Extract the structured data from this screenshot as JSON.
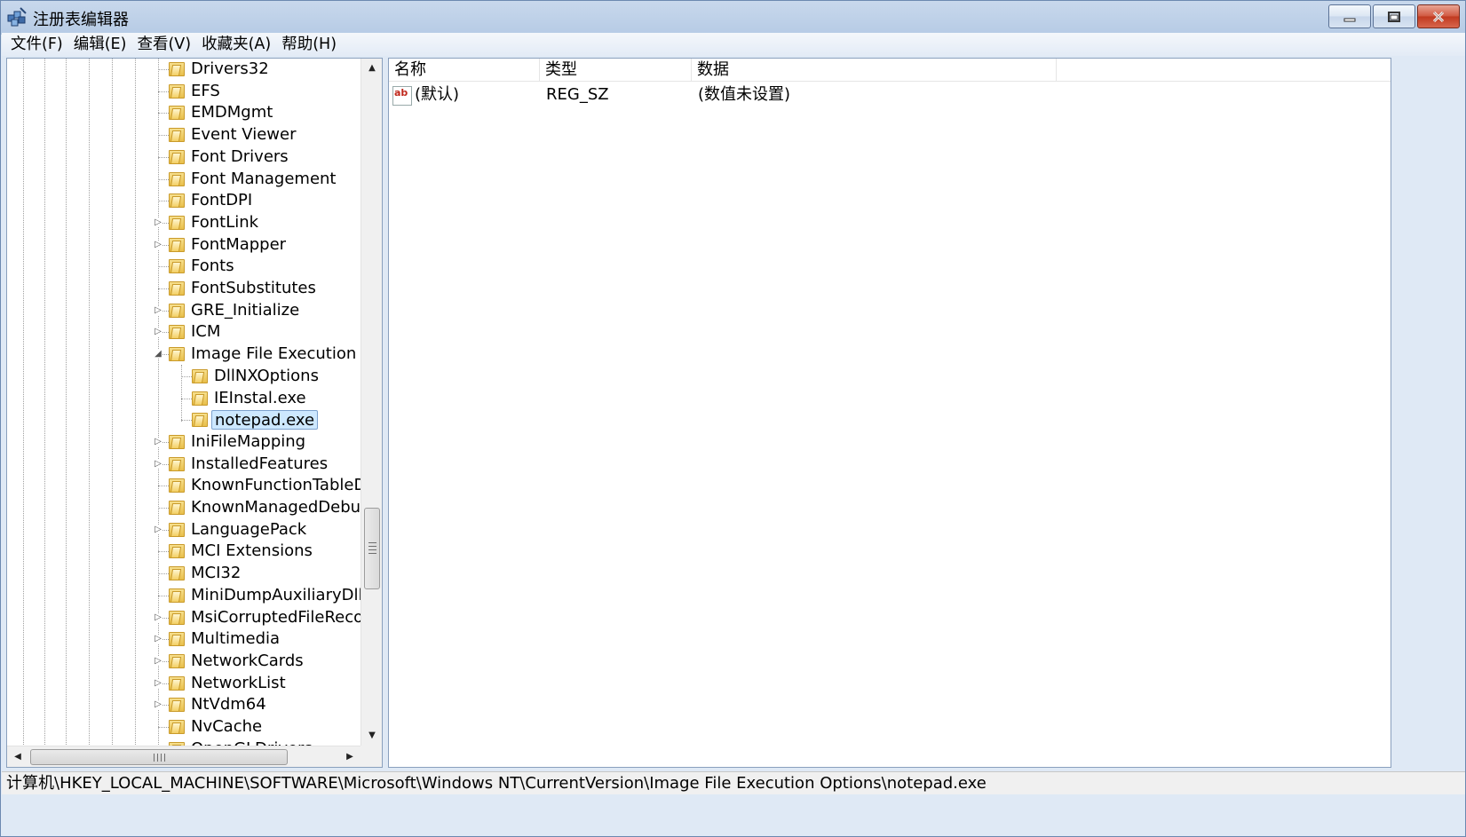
{
  "window": {
    "title": "注册表编辑器",
    "icon": "regedit-icon",
    "controls": {
      "minimize": "minimize-icon",
      "maximize": "maximize-icon",
      "close": "close-icon"
    }
  },
  "menubar": {
    "items": [
      "文件(F)",
      "编辑(E)",
      "查看(V)",
      "收藏夹(A)",
      "帮助(H)"
    ]
  },
  "tree": {
    "nodes": [
      {
        "label": "Drivers32",
        "expander": ""
      },
      {
        "label": "EFS",
        "expander": ""
      },
      {
        "label": "EMDMgmt",
        "expander": ""
      },
      {
        "label": "Event Viewer",
        "expander": ""
      },
      {
        "label": "Font Drivers",
        "expander": ""
      },
      {
        "label": "Font Management",
        "expander": ""
      },
      {
        "label": "FontDPI",
        "expander": ""
      },
      {
        "label": "FontLink",
        "expander": "▷"
      },
      {
        "label": "FontMapper",
        "expander": "▷"
      },
      {
        "label": "Fonts",
        "expander": ""
      },
      {
        "label": "FontSubstitutes",
        "expander": ""
      },
      {
        "label": "GRE_Initialize",
        "expander": "▷"
      },
      {
        "label": "ICM",
        "expander": "▷"
      },
      {
        "label": "Image File Execution O",
        "expander": "◢"
      },
      {
        "label": "DllNXOptions",
        "expander": "",
        "child": true
      },
      {
        "label": "IEInstal.exe",
        "expander": "",
        "child": true
      },
      {
        "label": "notepad.exe",
        "expander": "",
        "child": true,
        "selected": true
      },
      {
        "label": "IniFileMapping",
        "expander": "▷"
      },
      {
        "label": "InstalledFeatures",
        "expander": "▷"
      },
      {
        "label": "KnownFunctionTableDl",
        "expander": ""
      },
      {
        "label": "KnownManagedDebug",
        "expander": ""
      },
      {
        "label": "LanguagePack",
        "expander": "▷"
      },
      {
        "label": "MCI Extensions",
        "expander": ""
      },
      {
        "label": "MCI32",
        "expander": ""
      },
      {
        "label": "MiniDumpAuxiliaryDlls",
        "expander": ""
      },
      {
        "label": "MsiCorruptedFileRecov",
        "expander": "▷"
      },
      {
        "label": "Multimedia",
        "expander": "▷"
      },
      {
        "label": "NetworkCards",
        "expander": "▷"
      },
      {
        "label": "NetworkList",
        "expander": "▷"
      },
      {
        "label": "NtVdm64",
        "expander": "▷"
      },
      {
        "label": "NvCache",
        "expander": ""
      },
      {
        "label": "OpenGLDrivers",
        "expander": ""
      }
    ],
    "scroll": {
      "up": "▲",
      "down": "▼",
      "left": "◀",
      "right": "▶"
    }
  },
  "values_list": {
    "columns": [
      "名称",
      "类型",
      "数据"
    ],
    "rows": [
      {
        "icon": "ab",
        "name": "(默认)",
        "type": "REG_SZ",
        "data": "(数值未设置)"
      }
    ]
  },
  "statusbar": {
    "path": "计算机\\HKEY_LOCAL_MACHINE\\SOFTWARE\\Microsoft\\Windows NT\\CurrentVersion\\Image File Execution Options\\notepad.exe"
  }
}
